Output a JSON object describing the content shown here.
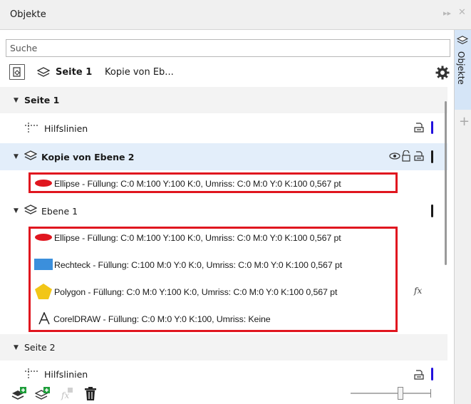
{
  "panel": {
    "title": "Objekte",
    "tab_label": "Objekte"
  },
  "search": {
    "placeholder": "Suche",
    "value": ""
  },
  "toolbar": {
    "page": "Seite 1",
    "layer": "Kopie von Eb..."
  },
  "tree": {
    "page1": {
      "label": "Seite 1"
    },
    "guides1": {
      "label": "Hilfslinien"
    },
    "layer_copy": {
      "label": "Kopie von Ebene 2"
    },
    "ellipse_copy": {
      "label": "Ellipse - Füllung: C:0 M:100 Y:100 K:0, Umriss: C:0 M:0 Y:0 K:100  0,567 pt"
    },
    "layer1": {
      "label": "Ebene 1"
    },
    "ellipse": {
      "label": "Ellipse - Füllung: C:0 M:100 Y:100 K:0, Umriss: C:0 M:0 Y:0 K:100  0,567 pt"
    },
    "rect": {
      "label": "Rechteck - Füllung: C:100 M:0 Y:0 K:0, Umriss: C:0 M:0 Y:0 K:100  0,567 pt"
    },
    "polygon": {
      "label": "Polygon - Füllung: C:0 M:0 Y:100 K:0, Umriss: C:0 M:0 Y:0 K:100  0,567 pt"
    },
    "text": {
      "label": "CorelDRAW - Füllung: C:0 M:0 Y:0 K:100, Umriss: Keine"
    },
    "page2": {
      "label": "Seite 2"
    },
    "guides2": {
      "label": "Hilfslinien"
    }
  },
  "colors": {
    "selection_bg": "#e3eefa",
    "highlight_red": "#e0161f",
    "ellipse_red": "#e0161f",
    "rect_blue": "#3b8fdc",
    "polygon_yellow": "#f2c617",
    "layer_marker_blue": "#2211dd",
    "layer_marker_black": "#1a1a1a"
  }
}
